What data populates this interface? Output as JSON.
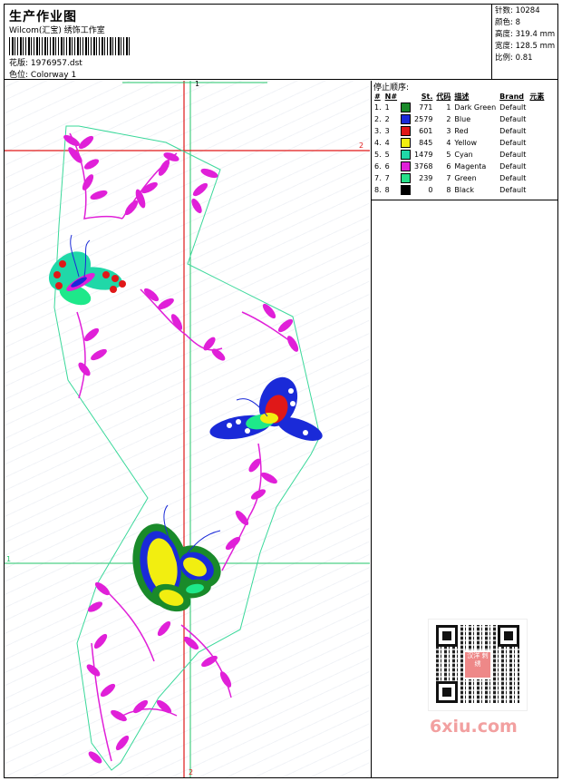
{
  "header": {
    "title": "生产作业图",
    "company": "Wilcom(汇宝) 绣饰工作室",
    "design_label": "花版:",
    "design_value": "1976957.dst",
    "colorway_label": "色位:",
    "colorway_value": "Colorway 1"
  },
  "stats": [
    {
      "label": "针数:",
      "value": "10284"
    },
    {
      "label": "颜色:",
      "value": "8"
    },
    {
      "label": "高度:",
      "value": "319.4 mm"
    },
    {
      "label": "宽度:",
      "value": "128.5 mm"
    },
    {
      "label": "比例:",
      "value": "0.81"
    }
  ],
  "stop_sequence": {
    "title": "停止顺序:",
    "columns": [
      "#",
      "N#",
      "St.",
      "代码",
      "描述",
      "Brand",
      "元素"
    ],
    "rows": [
      {
        "idx": "1.",
        "n": "1",
        "color": "#1a8a2a",
        "st": "771",
        "code": "1",
        "desc": "Dark Green",
        "brand": "Default"
      },
      {
        "idx": "2.",
        "n": "2",
        "color": "#1a2ad8",
        "st": "2579",
        "code": "2",
        "desc": "Blue",
        "brand": "Default"
      },
      {
        "idx": "3.",
        "n": "3",
        "color": "#e01818",
        "st": "601",
        "code": "3",
        "desc": "Red",
        "brand": "Default"
      },
      {
        "idx": "4.",
        "n": "4",
        "color": "#f2ee10",
        "st": "845",
        "code": "4",
        "desc": "Yellow",
        "brand": "Default"
      },
      {
        "idx": "5.",
        "n": "5",
        "color": "#20d8a8",
        "st": "1479",
        "code": "5",
        "desc": "Cyan",
        "brand": "Default"
      },
      {
        "idx": "6.",
        "n": "6",
        "color": "#e020d8",
        "st": "3768",
        "code": "6",
        "desc": "Magenta",
        "brand": "Default"
      },
      {
        "idx": "7.",
        "n": "7",
        "color": "#28e08a",
        "st": "239",
        "code": "7",
        "desc": "Green",
        "brand": "Default"
      },
      {
        "idx": "8.",
        "n": "8",
        "color": "#000000",
        "st": "0",
        "code": "8",
        "desc": "Black",
        "brand": "Default"
      }
    ]
  },
  "axes": {
    "top_label": "1",
    "right_label": "2",
    "left_label": "1",
    "bottom_label": "2"
  },
  "qr": {
    "center_text": "汉洋 刺绣"
  },
  "watermark": "6xiu.com",
  "colors": {
    "guide_red": "#e01818",
    "guide_green": "#22c46a",
    "outline": "#3ad89a",
    "magenta": "#e020d8"
  }
}
